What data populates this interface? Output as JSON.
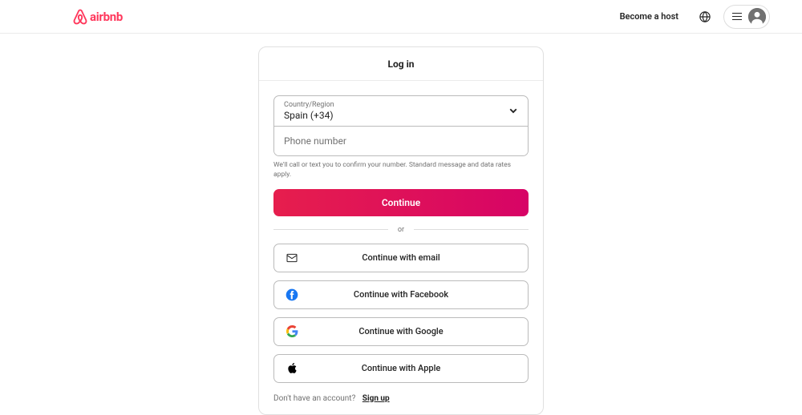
{
  "brand": {
    "name": "airbnb",
    "color": "#FF385C"
  },
  "header": {
    "host_link": "Become a host"
  },
  "modal": {
    "title": "Log in",
    "country_label": "Country/Region",
    "country_value": "Spain (+34)",
    "phone_placeholder": "Phone number",
    "disclaimer": "We'll call or text you to confirm your number. Standard message and data rates apply.",
    "continue_label": "Continue",
    "divider": "or",
    "social": {
      "email": "Continue with email",
      "facebook": "Continue with Facebook",
      "google": "Continue with Google",
      "apple": "Continue with Apple"
    },
    "signup_prompt": "Don't have an account?",
    "signup_link": "Sign up"
  }
}
